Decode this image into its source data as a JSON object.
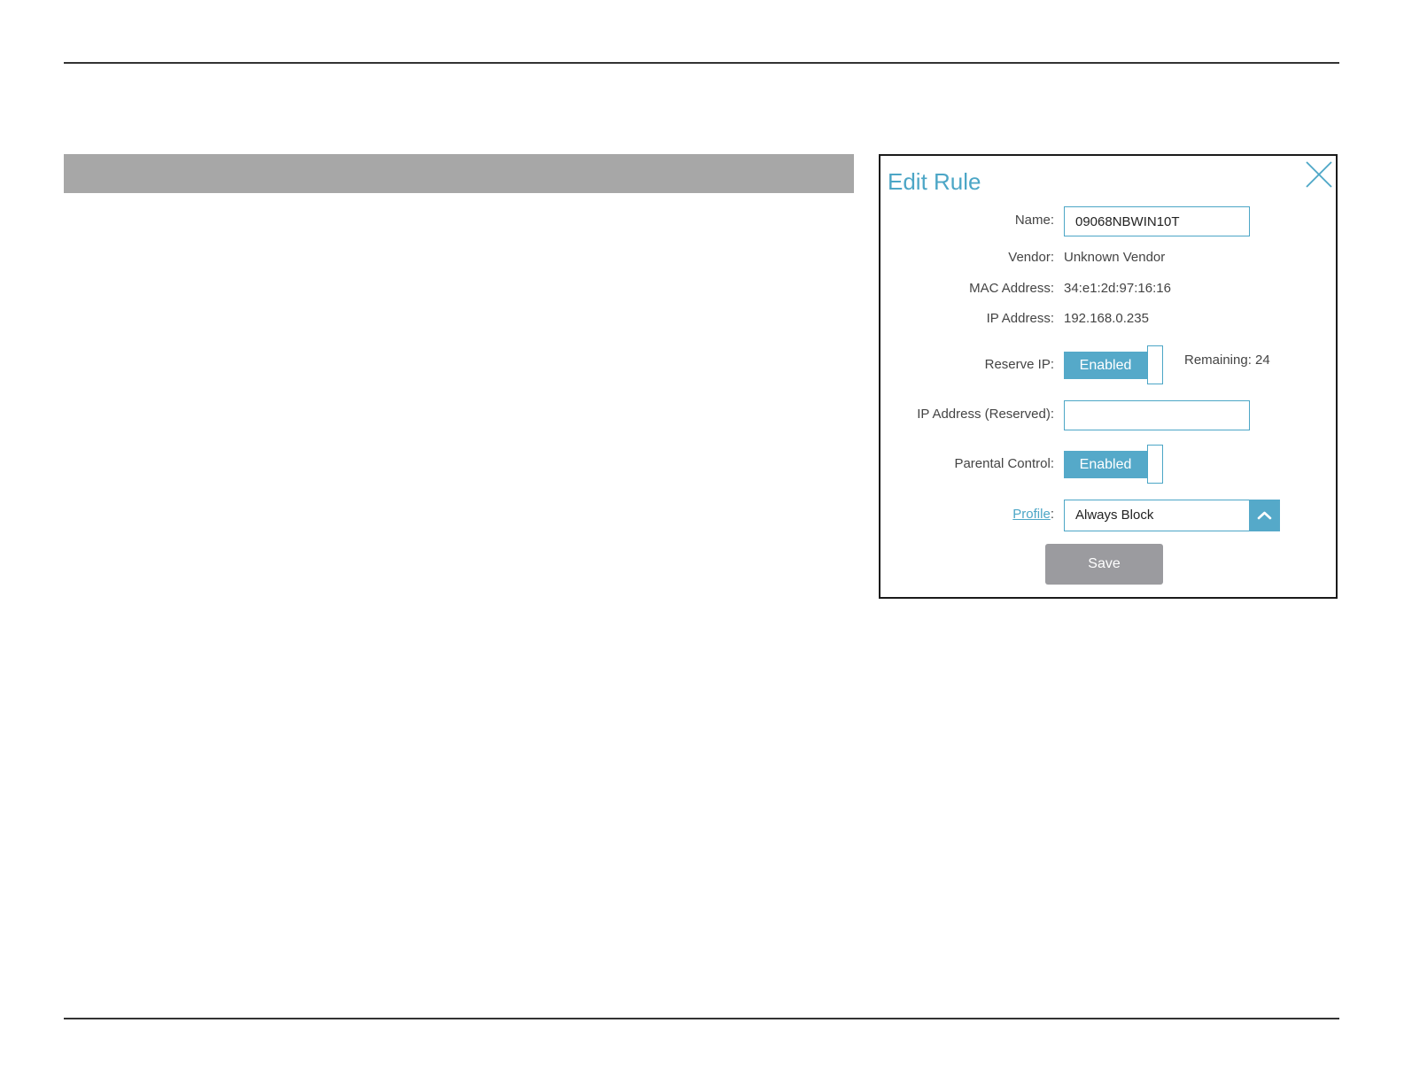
{
  "dialog": {
    "title": "Edit Rule",
    "fields": {
      "name_label": "Name:",
      "name_value": "09068NBWIN10T",
      "vendor_label": "Vendor:",
      "vendor_value": "Unknown Vendor",
      "mac_label": "MAC Address:",
      "mac_value": "34:e1:2d:97:16:16",
      "ip_label": "IP Address:",
      "ip_value": "192.168.0.235",
      "reserve_ip_label": "Reserve IP:",
      "reserve_ip_state": "Enabled",
      "remaining": "Remaining: 24",
      "ip_reserved_label": "IP Address (Reserved):",
      "ip_reserved_value": "",
      "parental_control_label": "Parental Control:",
      "parental_control_state": "Enabled",
      "profile_link": "Profile",
      "profile_colon": ":",
      "profile_value": "Always Block"
    },
    "save_label": "Save"
  },
  "icons": {
    "close": "close-icon",
    "dropdown": "chevron-up-icon"
  },
  "colors": {
    "accent": "#4ca6c6",
    "toggle_fill": "#55a9c9",
    "banner": "#a7a7a7",
    "save_button": "#9b9b9f"
  }
}
